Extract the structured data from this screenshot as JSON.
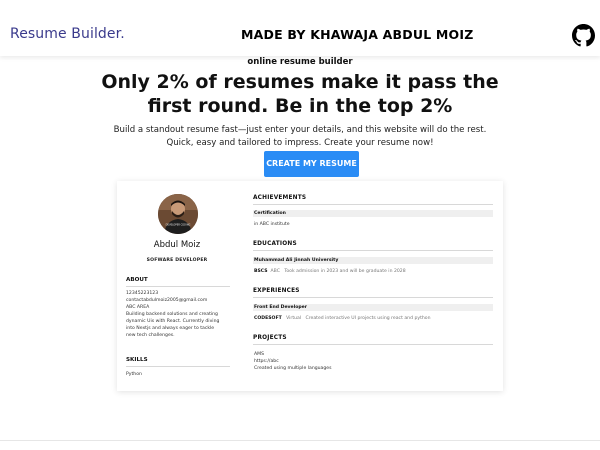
{
  "header": {
    "brand": "Resume Builder",
    "brand_dot": ".",
    "made_by": "MADE BY KHAWAJA ABDUL MOIZ",
    "icon": "github-icon"
  },
  "hero": {
    "subtitle": "online resume builder",
    "title": "Only 2% of resumes make it pass the first round. Be in the top 2%",
    "description": "Build a standout resume fast—just enter your details, and this website will do the rest. Quick, easy and tailored to impress. Create your resume now!",
    "cta_label": "CREATE MY RESUME"
  },
  "resume": {
    "name": "Abdul Moiz",
    "role": "SOFWARE DEVELOPER",
    "avatar_shirt_text": "DEVELOPER CODING",
    "about_heading": "ABOUT",
    "phone": "12345223123",
    "email": "contactabdulmoiz2005@gmail.com",
    "address": "ABC AREA",
    "bio_lines": [
      "Building backend solutions and creating",
      "dynamic Uis with React. Currently diving",
      "into Nextjs and always eager to tackle",
      "new tech challenges."
    ],
    "skills_heading": "SKILLS",
    "skill": "Python",
    "achievements_heading": "ACHIEVEMENTS",
    "achievement_title": "Certification",
    "achievement_detail": "in ABC institute",
    "educations_heading": "EDUCATIONS",
    "education_school": "Muhammad Ali Jinnah University",
    "education_degree": "BSCS",
    "education_org": "ABC",
    "education_note": "Took admission in 2023 and will be graduate in 2028",
    "experiences_heading": "EXPERIENCES",
    "experience_title": "Front End Developer",
    "experience_company": "CODESOFT",
    "experience_mode": "Virtual",
    "experience_note": "Created interactive UI projects using react and python",
    "projects_heading": "PROJECTS",
    "project_name": "AMS",
    "project_link": "https://abc",
    "project_note": "Created using multiple languages"
  }
}
